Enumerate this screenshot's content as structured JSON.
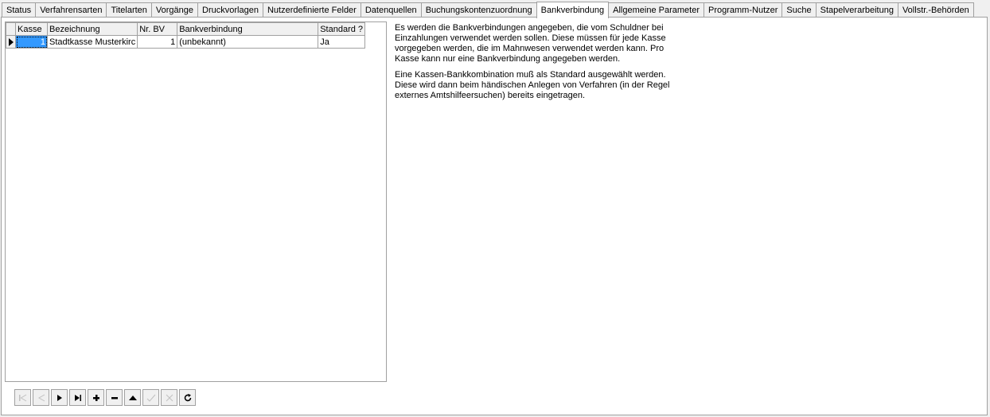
{
  "tabs": [
    {
      "label": "Status"
    },
    {
      "label": "Verfahrensarten"
    },
    {
      "label": "Titelarten"
    },
    {
      "label": "Vorgänge"
    },
    {
      "label": "Druckvorlagen"
    },
    {
      "label": "Nutzerdefinierte Felder"
    },
    {
      "label": "Datenquellen"
    },
    {
      "label": "Buchungskontenzuordnung"
    },
    {
      "label": "Bankverbindung",
      "active": true
    },
    {
      "label": "Allgemeine Parameter"
    },
    {
      "label": "Programm-Nutzer"
    },
    {
      "label": "Suche"
    },
    {
      "label": "Stapelverarbeitung"
    },
    {
      "label": "Vollstr.-Behörden"
    }
  ],
  "grid": {
    "columns": [
      "Kasse",
      "Bezeichnung",
      "Nr. BV",
      "Bankverbindung",
      "Standard ?"
    ],
    "rows": [
      {
        "kasse": "1",
        "bezeichnung": "Stadtkasse Musterkirc",
        "nr_bv": "1",
        "bankverbindung": "(unbekannt)",
        "standard": "Ja"
      }
    ]
  },
  "info": {
    "paragraph1": "Es werden die Bankverbindungen angegeben, die vom Schuldner bei Einzahlungen verwendet werden sollen. Diese müssen für jede Kasse vorgegeben werden, die im Mahnwesen verwendet werden kann. Pro Kasse kann nur eine Bankverbindung angegeben werden.",
    "paragraph2": "Eine Kassen-Bankkombination muß als Standard ausgewählt werden. Diese wird dann beim händischen Anlegen von Verfahren (in der Regel externes Amtshilfeersuchen) bereits eingetragen."
  },
  "navigator": [
    {
      "name": "first-record-button",
      "icon": "first-icon",
      "enabled": false
    },
    {
      "name": "prior-record-button",
      "icon": "prior-icon",
      "enabled": false
    },
    {
      "name": "next-record-button",
      "icon": "next-icon",
      "enabled": true
    },
    {
      "name": "last-record-button",
      "icon": "last-icon",
      "enabled": true
    },
    {
      "name": "insert-record-button",
      "icon": "plus-icon",
      "enabled": true
    },
    {
      "name": "delete-record-button",
      "icon": "minus-icon",
      "enabled": true
    },
    {
      "name": "edit-record-button",
      "icon": "up-triangle-icon",
      "enabled": true
    },
    {
      "name": "post-record-button",
      "icon": "check-icon",
      "enabled": false
    },
    {
      "name": "cancel-record-button",
      "icon": "cancel-icon",
      "enabled": false
    },
    {
      "name": "refresh-button",
      "icon": "refresh-icon",
      "enabled": true
    }
  ]
}
